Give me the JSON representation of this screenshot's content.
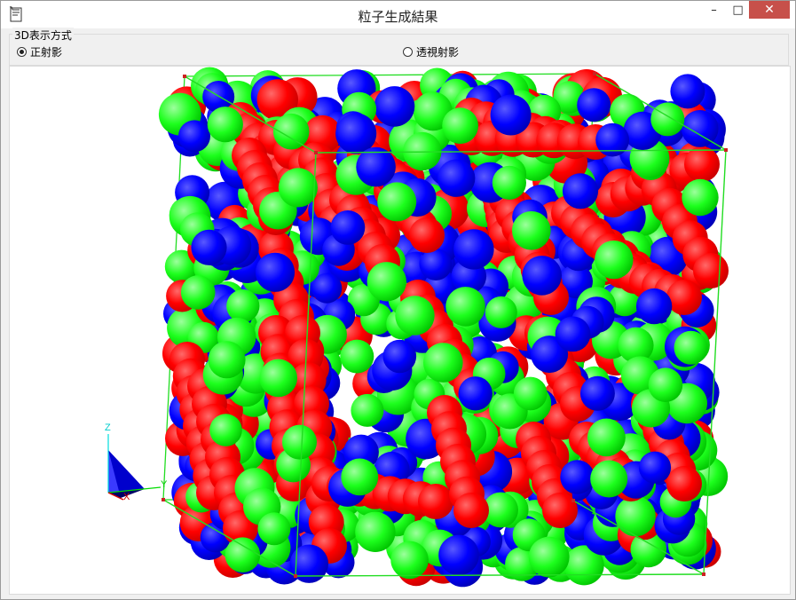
{
  "window": {
    "title": "粒子生成結果",
    "minimize_glyph": "–",
    "maximize_glyph": "□",
    "close_glyph": "✕",
    "app_icon": "document-icon"
  },
  "view_mode": {
    "group_label": "3D表示方式",
    "options": [
      {
        "label": "正射影",
        "selected": true
      },
      {
        "label": "透視射影",
        "selected": false
      }
    ]
  },
  "scene": {
    "axis_labels": {
      "z": "Z",
      "y": "Y",
      "x": "X"
    },
    "particle_colors": {
      "red": "#ff0000",
      "green": "#00ff00",
      "blue": "#0000ff"
    },
    "box_color": "#22dd22"
  }
}
